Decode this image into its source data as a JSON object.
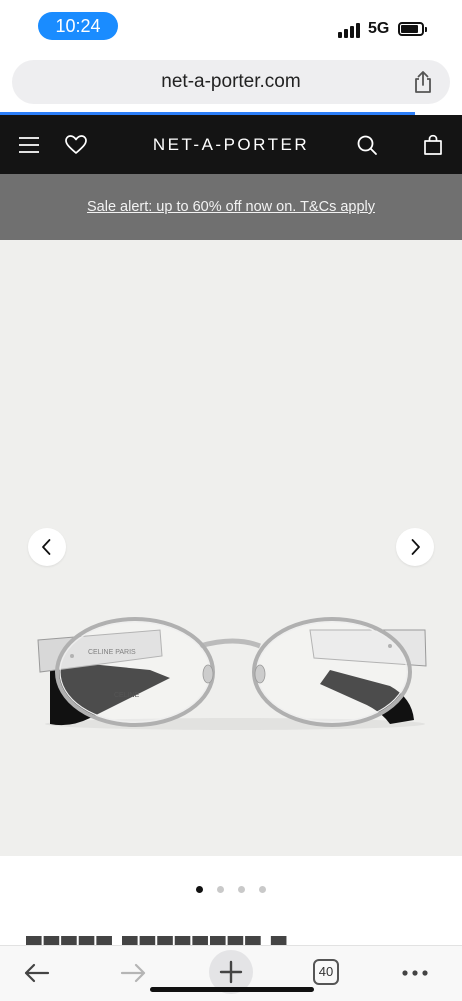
{
  "status_bar": {
    "time": "10:24",
    "network": "5G"
  },
  "browser": {
    "url": "net-a-porter.com",
    "tabs_count": "40"
  },
  "site": {
    "logo": "NET-A-PORTER",
    "sale_banner": "Sale alert: up to 60% off now on. T&Cs apply"
  },
  "product": {
    "brand_temple": "CELINE PARIS",
    "brand_lens": "CELINE",
    "gallery": {
      "total": 4,
      "active": 1
    }
  },
  "colors": {
    "header_bg": "#141414",
    "banner_bg": "#707070",
    "time_pill": "#1a8cff",
    "image_bg": "#efefed"
  }
}
